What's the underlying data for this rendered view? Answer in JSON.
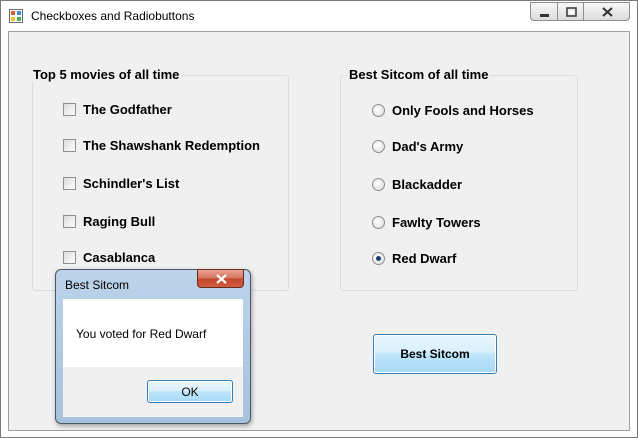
{
  "window": {
    "title": "Checkboxes and Radiobuttons"
  },
  "movies_group": {
    "title": "Top 5 movies of all time",
    "items": [
      {
        "label": "The Godfather",
        "checked": false
      },
      {
        "label": "The Shawshank Redemption",
        "checked": false
      },
      {
        "label": "Schindler's List",
        "checked": false
      },
      {
        "label": "Raging Bull",
        "checked": false
      },
      {
        "label": "Casablanca",
        "checked": false
      }
    ]
  },
  "sitcom_group": {
    "title": "Best Sitcom of all time",
    "items": [
      {
        "label": "Only Fools and Horses",
        "selected": false
      },
      {
        "label": "Dad's Army",
        "selected": false
      },
      {
        "label": "Blackadder",
        "selected": false
      },
      {
        "label": "Fawlty Towers",
        "selected": false
      },
      {
        "label": "Red Dwarf",
        "selected": true
      }
    ]
  },
  "sitcom_button": {
    "label": "Best Sitcom"
  },
  "message_box": {
    "title": "Best Sitcom",
    "message": "You voted for Red Dwarf",
    "ok_label": "OK"
  }
}
